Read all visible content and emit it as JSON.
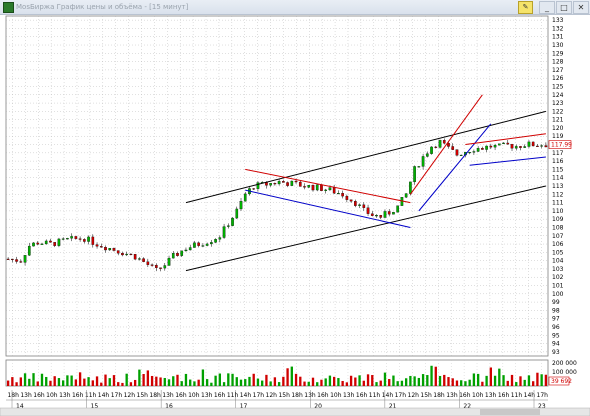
{
  "window": {
    "title": "MosБиржа График цены и объёма - [15 минут]",
    "tool_icon": "pencil-icon",
    "minimize_label": "_",
    "maximize_label": "□",
    "close_label": "✕"
  },
  "chart_data": {
    "type": "candlestick",
    "title": "",
    "ylim": [
      92.5,
      133.5
    ],
    "yticks": [
      133,
      132,
      131,
      130,
      129,
      128,
      127,
      126,
      125,
      124,
      123,
      122,
      121,
      120,
      119,
      118,
      117,
      116,
      115,
      114,
      113,
      112,
      111,
      110,
      109,
      108,
      107,
      106,
      105,
      104,
      103,
      102,
      101,
      100,
      99,
      98,
      97,
      96,
      95,
      94,
      93
    ],
    "current_price": "117.99",
    "volume": {
      "yticks": [
        "200 000",
        "100 000"
      ],
      "current_value": "39 692"
    },
    "x_hour_labels": [
      "18h",
      "13h",
      "16h",
      "10h",
      "13h",
      "16h",
      "11h",
      "14h",
      "17h",
      "12h",
      "15h",
      "18h",
      "13h",
      "16h",
      "10h",
      "13h",
      "16h",
      "11h",
      "14h",
      "17h",
      "12h",
      "15h",
      "18h",
      "13h",
      "16h",
      "10h",
      "13h",
      "16h",
      "11h",
      "14h",
      "17h",
      "12h",
      "15h",
      "18h",
      "13h",
      "16h",
      "10h",
      "13h",
      "16h",
      "11h",
      "14h",
      "17h"
    ],
    "x_date_labels": [
      "14",
      "15",
      "16",
      "17",
      "20",
      "21",
      "22",
      "23"
    ],
    "price_path": [
      [
        0,
        104.2
      ],
      [
        3,
        104
      ],
      [
        5,
        105.8
      ],
      [
        7,
        106.2
      ],
      [
        10,
        106
      ],
      [
        14,
        106.5
      ],
      [
        18,
        106.7
      ],
      [
        21,
        106
      ],
      [
        24,
        105.5
      ],
      [
        27,
        105
      ],
      [
        30,
        104.5
      ],
      [
        33,
        103.5
      ],
      [
        35,
        102.8
      ],
      [
        37,
        103.5
      ],
      [
        39,
        104.5
      ],
      [
        42,
        105.5
      ],
      [
        45,
        106
      ],
      [
        48,
        106.5
      ],
      [
        50,
        107
      ],
      [
        52,
        108.5
      ],
      [
        54,
        110
      ],
      [
        56,
        112
      ],
      [
        58,
        113
      ],
      [
        61,
        113.2
      ],
      [
        64,
        113.5
      ],
      [
        67,
        113.3
      ],
      [
        70,
        113
      ],
      [
        73,
        112.8
      ],
      [
        76,
        112.5
      ],
      [
        79,
        112
      ],
      [
        82,
        111
      ],
      [
        84,
        110
      ],
      [
        86,
        109.5
      ],
      [
        88,
        109.3
      ],
      [
        90,
        109.8
      ],
      [
        92,
        110.5
      ],
      [
        94,
        112
      ],
      [
        96,
        115
      ],
      [
        98,
        116.5
      ],
      [
        100,
        117.8
      ],
      [
        102,
        118.3
      ],
      [
        104,
        117.5
      ],
      [
        106,
        116.8
      ],
      [
        108,
        117.2
      ],
      [
        110,
        117.5
      ],
      [
        112,
        117.6
      ],
      [
        114,
        117.8
      ],
      [
        116,
        117.7
      ],
      [
        118,
        117.9
      ],
      [
        120,
        117.8
      ],
      [
        122,
        118
      ],
      [
        124,
        117.99
      ]
    ],
    "trendlines": [
      {
        "color": "#000000",
        "from": [
          42,
          111
        ],
        "to": [
          127,
          122
        ]
      },
      {
        "color": "#000000",
        "from": [
          42,
          102.8
        ],
        "to": [
          127,
          113
        ]
      },
      {
        "color": "#d00000",
        "from": [
          56,
          115
        ],
        "to": [
          95,
          111
        ]
      },
      {
        "color": "#0000c8",
        "from": [
          56,
          112.5
        ],
        "to": [
          95,
          108
        ]
      },
      {
        "color": "#d00000",
        "from": [
          95,
          112
        ],
        "to": [
          112,
          124
        ]
      },
      {
        "color": "#0000c8",
        "from": [
          97,
          110
        ],
        "to": [
          114,
          120.5
        ]
      },
      {
        "color": "#d00000",
        "from": [
          108,
          118
        ],
        "to": [
          127,
          119.3
        ]
      },
      {
        "color": "#0000c8",
        "from": [
          109,
          115.5
        ],
        "to": [
          127,
          116.5
        ]
      }
    ]
  }
}
